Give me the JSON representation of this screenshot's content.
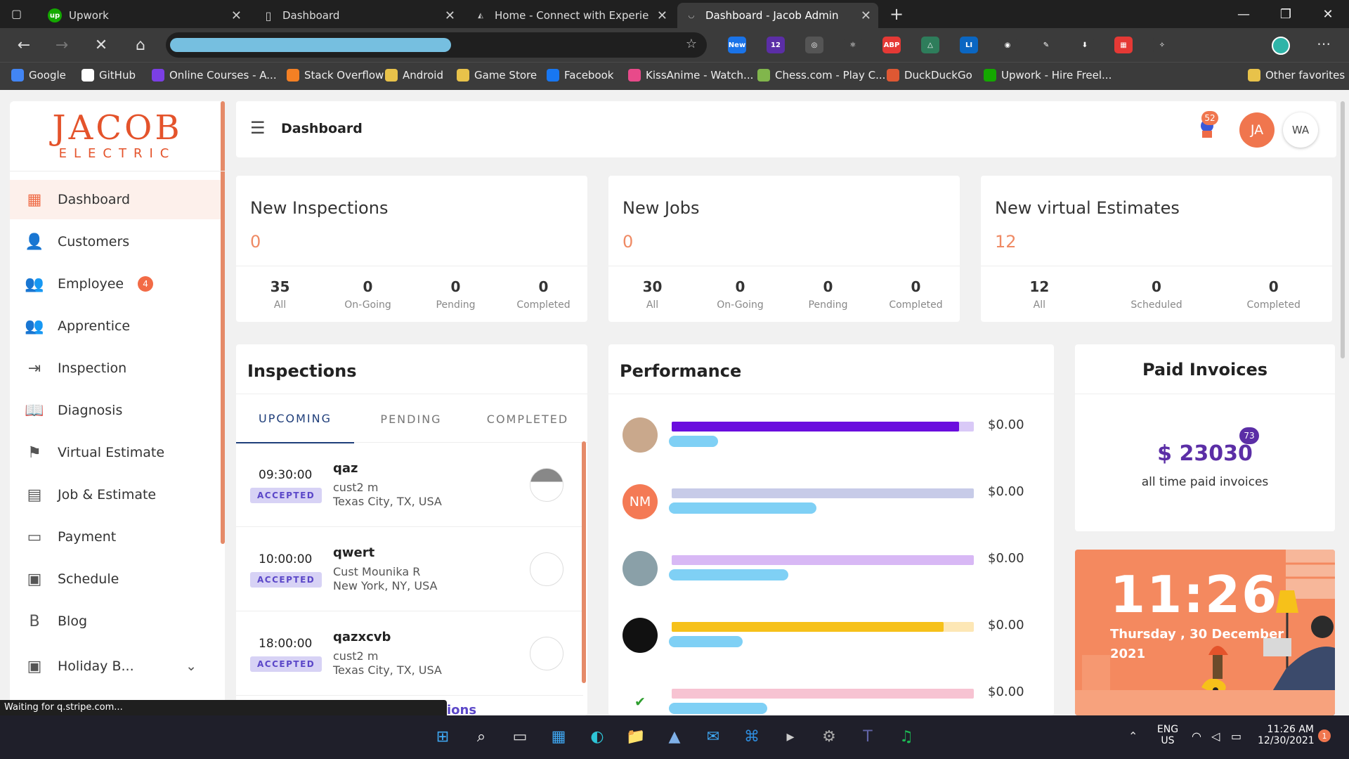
{
  "browser": {
    "tabs": [
      {
        "title": "Upwork",
        "icon_bg": "#14a800",
        "icon_text": "up"
      },
      {
        "title": "Dashboard",
        "icon_bg": "#202020",
        "icon_text": "▯"
      },
      {
        "title": "Home - Connect with Experience",
        "icon_bg": "#202020",
        "icon_text": "◭"
      },
      {
        "title": "Dashboard - Jacob Admin",
        "icon_bg": "#3b3b3b",
        "icon_text": "◡"
      }
    ],
    "new_tab": "+",
    "window_controls": [
      "—",
      "❐",
      "✕"
    ],
    "bookmarks": [
      {
        "label": "Google",
        "color": "#4285f4"
      },
      {
        "label": "GitHub",
        "color": "#ffffff"
      },
      {
        "label": "Online Courses - A...",
        "color": "#7b3fe4"
      },
      {
        "label": "Stack Overflow",
        "color": "#f48024"
      },
      {
        "label": "Android",
        "color": "#e8c24a"
      },
      {
        "label": "Game Store",
        "color": "#e8c24a"
      },
      {
        "label": "Facebook",
        "color": "#1877f2"
      },
      {
        "label": "KissAnime - Watch...",
        "color": "#e84a8a"
      },
      {
        "label": "Chess.com - Play C...",
        "color": "#81b64c"
      },
      {
        "label": "DuckDuckGo",
        "color": "#de5833"
      },
      {
        "label": "Upwork - Hire Freel...",
        "color": "#14a800"
      },
      {
        "label": "Other favorites",
        "color": "#e8c24a"
      }
    ],
    "extensions": [
      {
        "label": "New",
        "bg": "#1a73e8"
      },
      {
        "label": "12",
        "bg": "#5b2ea6"
      },
      {
        "label": "◎",
        "bg": "#555555"
      },
      {
        "label": "⚛",
        "bg": "#3b3b3b"
      },
      {
        "label": "ABP",
        "bg": "#e53935"
      },
      {
        "label": "△",
        "bg": "#2e7d5b"
      },
      {
        "label": "LI",
        "bg": "#0a66c2"
      },
      {
        "label": "◉",
        "bg": "#3b3b3b"
      },
      {
        "label": "✎",
        "bg": "#3b3b3b"
      },
      {
        "label": "⬇",
        "bg": "#3b3b3b"
      },
      {
        "label": "▦",
        "bg": "#e53935"
      },
      {
        "label": "✧",
        "bg": "#3b3b3b"
      }
    ],
    "status": "Waiting for q.stripe.com..."
  },
  "app": {
    "logo_top": "JACOB",
    "logo_bottom": "ELECTRIC",
    "header_title": "Dashboard",
    "notification_count": "52",
    "user_initials": "JA",
    "workspace_initials": "WA",
    "nav": [
      {
        "label": "Dashboard",
        "icon": "▦"
      },
      {
        "label": "Customers",
        "icon": "👤"
      },
      {
        "label": "Employee",
        "icon": "👥",
        "badge": "4"
      },
      {
        "label": "Apprentice",
        "icon": "👥"
      },
      {
        "label": "Inspection",
        "icon": "⇥"
      },
      {
        "label": "Diagnosis",
        "icon": "📖"
      },
      {
        "label": "Virtual Estimate",
        "icon": "⚑"
      },
      {
        "label": "Job & Estimate",
        "icon": "▤"
      },
      {
        "label": "Payment",
        "icon": "▭"
      },
      {
        "label": "Schedule",
        "icon": "▣"
      },
      {
        "label": "Blog",
        "icon": "B"
      },
      {
        "label": "Holiday B...",
        "icon": "▣",
        "chevron": "⌄"
      }
    ],
    "stats": [
      {
        "title": "New Inspections",
        "value": "0",
        "items": [
          {
            "n": "35",
            "l": "All"
          },
          {
            "n": "0",
            "l": "On-Going"
          },
          {
            "n": "0",
            "l": "Pending"
          },
          {
            "n": "0",
            "l": "Completed"
          }
        ]
      },
      {
        "title": "New Jobs",
        "value": "0",
        "items": [
          {
            "n": "30",
            "l": "All"
          },
          {
            "n": "0",
            "l": "On-Going"
          },
          {
            "n": "0",
            "l": "Pending"
          },
          {
            "n": "0",
            "l": "Completed"
          }
        ]
      },
      {
        "title": "New virtual Estimates",
        "value": "12",
        "items": [
          {
            "n": "12",
            "l": "All"
          },
          {
            "n": "0",
            "l": "Scheduled"
          },
          {
            "n": "0",
            "l": "Completed"
          }
        ]
      }
    ],
    "inspections": {
      "title": "Inspections",
      "tabs": [
        "UPCOMING",
        "PENDING",
        "COMPLETED"
      ],
      "rows": [
        {
          "time": "09:30:00",
          "status": "ACCEPTED",
          "name": "qaz",
          "customer": "cust2 m",
          "location": "Texas City, TX, USA"
        },
        {
          "time": "10:00:00",
          "status": "ACCEPTED",
          "name": "qwert",
          "customer": "Cust Mounika R",
          "location": "New York, NY, USA"
        },
        {
          "time": "18:00:00",
          "status": "ACCEPTED",
          "name": "qazxcvb",
          "customer": "cust2 m",
          "location": "Texas City, TX, USA"
        }
      ],
      "more_link": "ions"
    },
    "performance": {
      "title": "Performance",
      "rows": [
        {
          "initials": "",
          "avatar_bg": "#c9a88c",
          "track": "#d9c9f7",
          "bar": "#6a0dde",
          "progress": 0.95,
          "amount": "$0.00"
        },
        {
          "initials": "NM",
          "avatar_bg": "#f47a55",
          "track": "#c7cbe8",
          "bar": "#c7cbe8",
          "progress": 0.0,
          "amount": "$0.00"
        },
        {
          "initials": "",
          "avatar_bg": "#8aa0a8",
          "track": "#d8b8f5",
          "bar": "#d8b8f5",
          "progress": 0.0,
          "amount": "$0.00"
        },
        {
          "initials": "",
          "avatar_bg": "#111111",
          "track": "#fde7b5",
          "bar": "#f6c11a",
          "progress": 0.9,
          "amount": "$0.00"
        },
        {
          "initials": "✔",
          "avatar_bg": "#ffffff",
          "track": "#f7c3d2",
          "bar": "#f7c3d2",
          "progress": 0.0,
          "amount": "$0.00"
        }
      ]
    },
    "invoices": {
      "title": "Paid Invoices",
      "badge": "73",
      "amount": "$ 23030",
      "caption": "all time paid invoices"
    },
    "clock": {
      "time": "11:26",
      "day": "Thursday , 30 December",
      "year": "2021"
    }
  },
  "taskbar": {
    "apps": [
      "⊞",
      "⌕",
      "▭",
      "▦",
      "◐",
      "📁",
      "▲",
      "✉",
      "⌘",
      "▸",
      "⚙",
      "T",
      "♫"
    ],
    "lang": "ENG",
    "region": "US",
    "time": "11:26 AM",
    "date": "12/30/2021",
    "notif": "1"
  },
  "colors": {
    "accent": "#ef8a64",
    "brand": "#e4532b",
    "primary": "#1f3e7a",
    "purple": "#5b47c8"
  }
}
